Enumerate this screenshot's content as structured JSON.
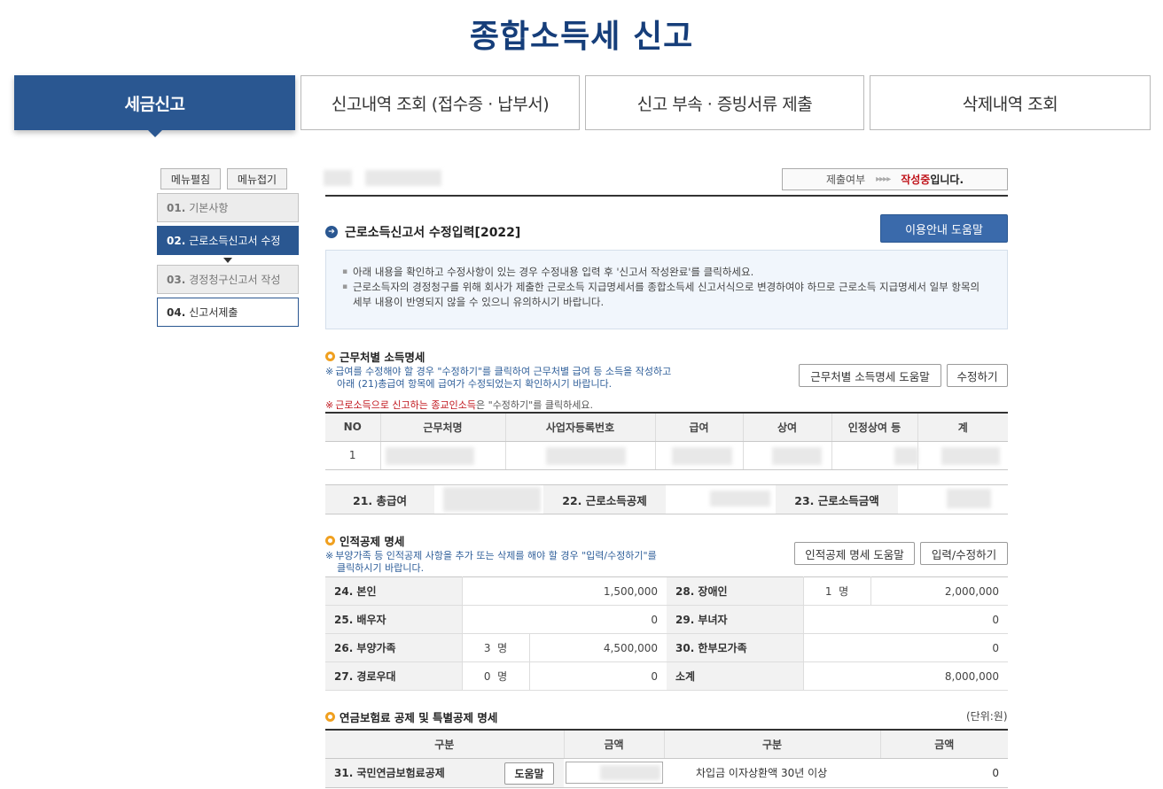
{
  "page": {
    "title": "종합소득세 신고"
  },
  "tabs": [
    {
      "label": "세금신고"
    },
    {
      "label": "신고내역 조회 (접수증 · 납부서)"
    },
    {
      "label": "신고 부속 · 증빙서류 제출"
    },
    {
      "label": "삭제내역 조회"
    }
  ],
  "side": {
    "expand": "메뉴펼침",
    "collapse": "메뉴접기",
    "steps": [
      {
        "num": "01.",
        "label": "기본사항"
      },
      {
        "num": "02.",
        "label": "근로소득신고서 수정"
      },
      {
        "num": "03.",
        "label": "경정청구신고서 작성"
      },
      {
        "num": "04.",
        "label": "신고서제출"
      }
    ]
  },
  "status": {
    "label": "제출여부",
    "arrows": "▸▸▸▸",
    "value": "작성중",
    "suffix": "입니다."
  },
  "section": {
    "title": "근로소득신고서 수정입력[2022]",
    "help_button": "이용안내 도움말"
  },
  "info": [
    "아래 내용을 확인하고 수정사항이 있는 경우 수정내용 입력 후 '신고서 작성완료'를 클릭하세요.",
    "근로소득자의 경정청구를 위해 회사가 제출한 근로소득 지급명세서를 종합소득세 신고서식으로 변경하여야 하므로 근로소득 지급명세서 일부 항목의 세부 내용이 반영되지 않을 수 있으니 유의하시기 바랍니다."
  ],
  "income": {
    "title": "근무처별 소득명세",
    "note_mark": "※",
    "note1": "급여를 수정해야 할 경우 \"수정하기\"를 클릭하여 근무처별 급여 등 소득을 작성하고",
    "note2": "아래 (21)총급여 항목에 급여가 수정되었는지 확인하시기 바랍니다.",
    "note_red": "근로소득으로 신고하는 종교인소득",
    "note_red_rest": "은 \"수정하기\"를 클릭하세요.",
    "help_button": "근무처별 소득명세 도움말",
    "edit_button": "수정하기",
    "columns": [
      "NO",
      "근무처명",
      "사업자등록번호",
      "급여",
      "상여",
      "인정상여 등",
      "계"
    ],
    "rows": [
      {
        "no": "1"
      }
    ],
    "summary": [
      "21. 총급여",
      "22. 근로소득공제",
      "23. 근로소득금액"
    ]
  },
  "deduction": {
    "title": "인적공제 명세",
    "note_mark": "※",
    "note1": "부양가족 등 인적공제 사항을 추가 또는 삭제를 해야 할 경우 \"입력/수정하기\"를",
    "note2": "클릭하시기 바랍니다.",
    "help_button": "인적공제 명세 도움말",
    "edit_button": "입력/수정하기",
    "unit_person": "명",
    "rows": [
      {
        "l_label": "24. 본인",
        "l_count": "",
        "l_amount": "1,500,000",
        "r_label": "28. 장애인",
        "r_count": "1",
        "r_amount": "2,000,000"
      },
      {
        "l_label": "25. 배우자",
        "l_count": "",
        "l_amount": "0",
        "r_label": "29. 부녀자",
        "r_count": "",
        "r_amount": "0"
      },
      {
        "l_label": "26. 부양가족",
        "l_count": "3",
        "l_amount": "4,500,000",
        "r_label": "30. 한부모가족",
        "r_count": "",
        "r_amount": "0"
      },
      {
        "l_label": "27. 경로우대",
        "l_count": "0",
        "l_amount": "0",
        "r_label": "소계",
        "r_count": "",
        "r_amount": "8,000,000"
      }
    ]
  },
  "pension": {
    "title": "연금보험료 공제 및 특별공제 명세",
    "unit": "(단위:원)",
    "columns": [
      "구분",
      "금액",
      "구분",
      "금액"
    ],
    "row": {
      "label": "31. 국민연금보험료공제",
      "help": "도움말",
      "r_label": "차입금 이자상환액 30년 이상",
      "r_amount": "0"
    }
  }
}
